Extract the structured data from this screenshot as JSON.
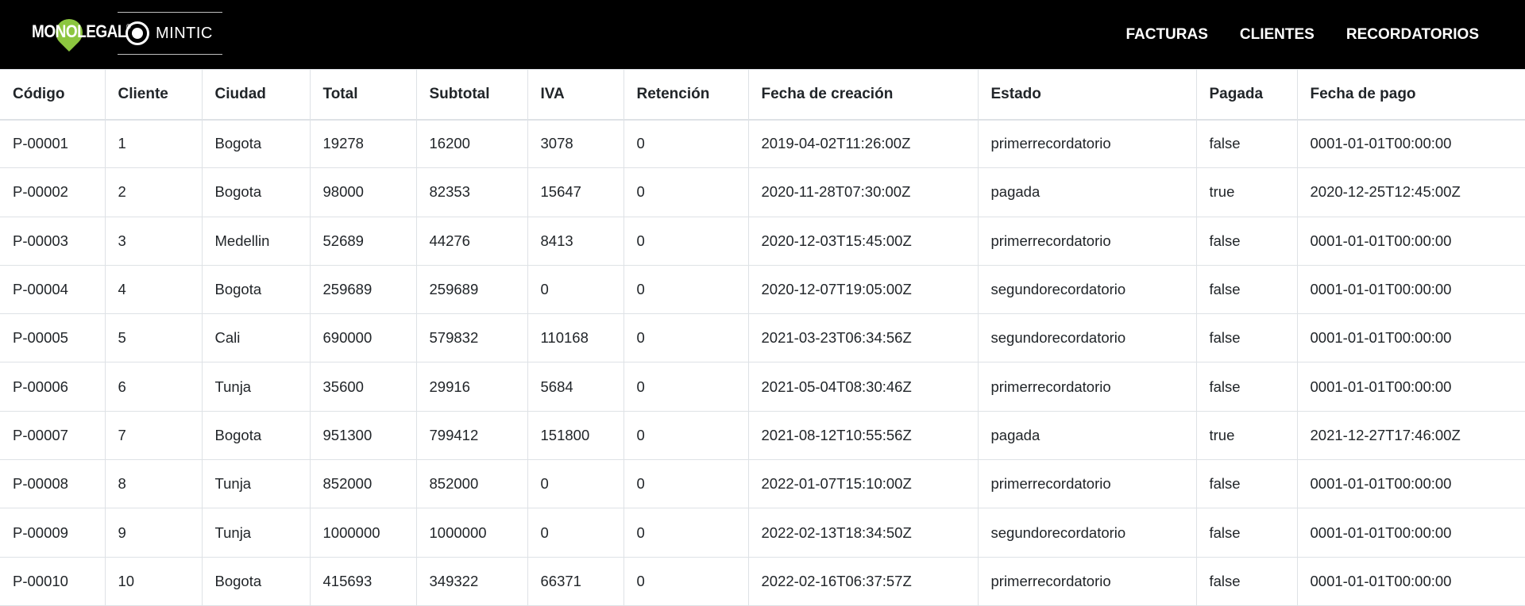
{
  "brand": {
    "logo_text": "MONOLEGAL",
    "logo_reg": "®",
    "partner_text": "MINTIC"
  },
  "nav": {
    "items": [
      "FACTURAS",
      "CLIENTES",
      "RECORDATORIOS"
    ]
  },
  "table": {
    "headers": [
      "Código",
      "Cliente",
      "Ciudad",
      "Total",
      "Subtotal",
      "IVA",
      "Retención",
      "Fecha de creación",
      "Estado",
      "Pagada",
      "Fecha de pago"
    ],
    "rows": [
      [
        "P-00001",
        "1",
        "Bogota",
        "19278",
        "16200",
        "3078",
        "0",
        "2019-04-02T11:26:00Z",
        "primerrecordatorio",
        "false",
        "0001-01-01T00:00:00"
      ],
      [
        "P-00002",
        "2",
        "Bogota",
        "98000",
        "82353",
        "15647",
        "0",
        "2020-11-28T07:30:00Z",
        "pagada",
        "true",
        "2020-12-25T12:45:00Z"
      ],
      [
        "P-00003",
        "3",
        "Medellin",
        "52689",
        "44276",
        "8413",
        "0",
        "2020-12-03T15:45:00Z",
        "primerrecordatorio",
        "false",
        "0001-01-01T00:00:00"
      ],
      [
        "P-00004",
        "4",
        "Bogota",
        "259689",
        "259689",
        "0",
        "0",
        "2020-12-07T19:05:00Z",
        "segundorecordatorio",
        "false",
        "0001-01-01T00:00:00"
      ],
      [
        "P-00005",
        "5",
        "Cali",
        "690000",
        "579832",
        "110168",
        "0",
        "2021-03-23T06:34:56Z",
        "segundorecordatorio",
        "false",
        "0001-01-01T00:00:00"
      ],
      [
        "P-00006",
        "6",
        "Tunja",
        "35600",
        "29916",
        "5684",
        "0",
        "2021-05-04T08:30:46Z",
        "primerrecordatorio",
        "false",
        "0001-01-01T00:00:00"
      ],
      [
        "P-00007",
        "7",
        "Bogota",
        "951300",
        "799412",
        "151800",
        "0",
        "2021-08-12T10:55:56Z",
        "pagada",
        "true",
        "2021-12-27T17:46:00Z"
      ],
      [
        "P-00008",
        "8",
        "Tunja",
        "852000",
        "852000",
        "0",
        "0",
        "2022-01-07T15:10:00Z",
        "primerrecordatorio",
        "false",
        "0001-01-01T00:00:00"
      ],
      [
        "P-00009",
        "9",
        "Tunja",
        "1000000",
        "1000000",
        "0",
        "0",
        "2022-02-13T18:34:50Z",
        "segundorecordatorio",
        "false",
        "0001-01-01T00:00:00"
      ],
      [
        "P-00010",
        "10",
        "Bogota",
        "415693",
        "349322",
        "66371",
        "0",
        "2022-02-16T06:37:57Z",
        "primerrecordatorio",
        "false",
        "0001-01-01T00:00:00"
      ]
    ]
  },
  "colors": {
    "navbar_bg": "#000000",
    "logo_pin": "#8cc63f",
    "border": "#dee2e6",
    "text": "#212529"
  }
}
